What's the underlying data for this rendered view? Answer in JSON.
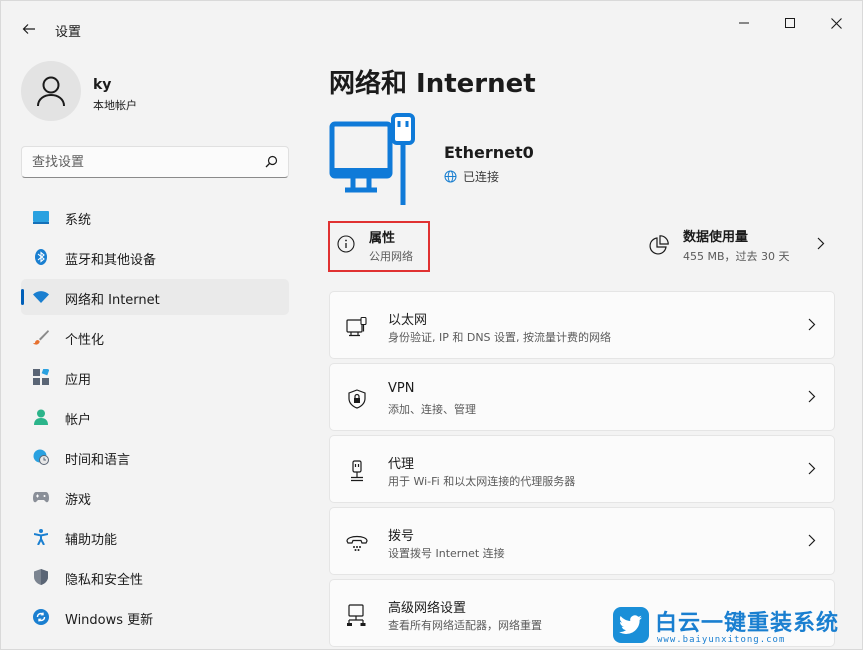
{
  "window": {
    "title": "设置"
  },
  "profile": {
    "name": "ky",
    "account_type": "本地帐户"
  },
  "search": {
    "placeholder": "查找设置"
  },
  "nav": {
    "items": [
      {
        "label": "系统",
        "icon": "system-icon"
      },
      {
        "label": "蓝牙和其他设备",
        "icon": "bluetooth-icon"
      },
      {
        "label": "网络和 Internet",
        "icon": "wifi-icon",
        "selected": true
      },
      {
        "label": "个性化",
        "icon": "brush-icon"
      },
      {
        "label": "应用",
        "icon": "apps-icon"
      },
      {
        "label": "帐户",
        "icon": "account-icon"
      },
      {
        "label": "时间和语言",
        "icon": "globe-clock-icon"
      },
      {
        "label": "游戏",
        "icon": "gamepad-icon"
      },
      {
        "label": "辅助功能",
        "icon": "accessibility-icon"
      },
      {
        "label": "隐私和安全性",
        "icon": "shield-icon"
      },
      {
        "label": "Windows 更新",
        "icon": "update-icon"
      }
    ]
  },
  "main": {
    "title": "网络和 Internet",
    "adapter": {
      "name": "Ethernet0",
      "status": "已连接"
    },
    "properties": {
      "title": "属性",
      "subtitle": "公用网络"
    },
    "data_usage": {
      "title": "数据使用量",
      "subtitle": "455 MB，过去 30 天"
    },
    "cards": [
      {
        "title": "以太网",
        "subtitle": "身份验证, IP 和 DNS 设置, 按流量计费的网络",
        "icon": "ethernet-icon"
      },
      {
        "title": "VPN",
        "subtitle": "添加、连接、管理",
        "icon": "vpn-shield-icon"
      },
      {
        "title": "代理",
        "subtitle": "用于 Wi-Fi 和以太网连接的代理服务器",
        "icon": "proxy-icon"
      },
      {
        "title": "拨号",
        "subtitle": "设置拨号 Internet 连接",
        "icon": "dialup-icon"
      },
      {
        "title": "高级网络设置",
        "subtitle": "查看所有网络适配器，网络重置",
        "icon": "advanced-network-icon"
      }
    ]
  },
  "watermark": {
    "title": "白云一键重装系统",
    "url": "www.baiyunxitong.com"
  },
  "colors": {
    "accent": "#005fb8",
    "highlight_box": "#e03131",
    "hero_blue": "#0f7ad8"
  }
}
